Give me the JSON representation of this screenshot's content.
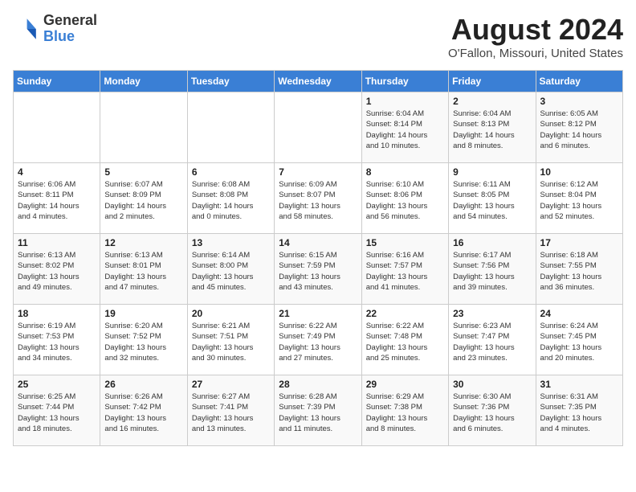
{
  "header": {
    "logo_line1": "General",
    "logo_line2": "Blue",
    "month": "August 2024",
    "location": "O'Fallon, Missouri, United States"
  },
  "weekdays": [
    "Sunday",
    "Monday",
    "Tuesday",
    "Wednesday",
    "Thursday",
    "Friday",
    "Saturday"
  ],
  "weeks": [
    [
      {
        "day": "",
        "info": ""
      },
      {
        "day": "",
        "info": ""
      },
      {
        "day": "",
        "info": ""
      },
      {
        "day": "",
        "info": ""
      },
      {
        "day": "1",
        "info": "Sunrise: 6:04 AM\nSunset: 8:14 PM\nDaylight: 14 hours\nand 10 minutes."
      },
      {
        "day": "2",
        "info": "Sunrise: 6:04 AM\nSunset: 8:13 PM\nDaylight: 14 hours\nand 8 minutes."
      },
      {
        "day": "3",
        "info": "Sunrise: 6:05 AM\nSunset: 8:12 PM\nDaylight: 14 hours\nand 6 minutes."
      }
    ],
    [
      {
        "day": "4",
        "info": "Sunrise: 6:06 AM\nSunset: 8:11 PM\nDaylight: 14 hours\nand 4 minutes."
      },
      {
        "day": "5",
        "info": "Sunrise: 6:07 AM\nSunset: 8:09 PM\nDaylight: 14 hours\nand 2 minutes."
      },
      {
        "day": "6",
        "info": "Sunrise: 6:08 AM\nSunset: 8:08 PM\nDaylight: 14 hours\nand 0 minutes."
      },
      {
        "day": "7",
        "info": "Sunrise: 6:09 AM\nSunset: 8:07 PM\nDaylight: 13 hours\nand 58 minutes."
      },
      {
        "day": "8",
        "info": "Sunrise: 6:10 AM\nSunset: 8:06 PM\nDaylight: 13 hours\nand 56 minutes."
      },
      {
        "day": "9",
        "info": "Sunrise: 6:11 AM\nSunset: 8:05 PM\nDaylight: 13 hours\nand 54 minutes."
      },
      {
        "day": "10",
        "info": "Sunrise: 6:12 AM\nSunset: 8:04 PM\nDaylight: 13 hours\nand 52 minutes."
      }
    ],
    [
      {
        "day": "11",
        "info": "Sunrise: 6:13 AM\nSunset: 8:02 PM\nDaylight: 13 hours\nand 49 minutes."
      },
      {
        "day": "12",
        "info": "Sunrise: 6:13 AM\nSunset: 8:01 PM\nDaylight: 13 hours\nand 47 minutes."
      },
      {
        "day": "13",
        "info": "Sunrise: 6:14 AM\nSunset: 8:00 PM\nDaylight: 13 hours\nand 45 minutes."
      },
      {
        "day": "14",
        "info": "Sunrise: 6:15 AM\nSunset: 7:59 PM\nDaylight: 13 hours\nand 43 minutes."
      },
      {
        "day": "15",
        "info": "Sunrise: 6:16 AM\nSunset: 7:57 PM\nDaylight: 13 hours\nand 41 minutes."
      },
      {
        "day": "16",
        "info": "Sunrise: 6:17 AM\nSunset: 7:56 PM\nDaylight: 13 hours\nand 39 minutes."
      },
      {
        "day": "17",
        "info": "Sunrise: 6:18 AM\nSunset: 7:55 PM\nDaylight: 13 hours\nand 36 minutes."
      }
    ],
    [
      {
        "day": "18",
        "info": "Sunrise: 6:19 AM\nSunset: 7:53 PM\nDaylight: 13 hours\nand 34 minutes."
      },
      {
        "day": "19",
        "info": "Sunrise: 6:20 AM\nSunset: 7:52 PM\nDaylight: 13 hours\nand 32 minutes."
      },
      {
        "day": "20",
        "info": "Sunrise: 6:21 AM\nSunset: 7:51 PM\nDaylight: 13 hours\nand 30 minutes."
      },
      {
        "day": "21",
        "info": "Sunrise: 6:22 AM\nSunset: 7:49 PM\nDaylight: 13 hours\nand 27 minutes."
      },
      {
        "day": "22",
        "info": "Sunrise: 6:22 AM\nSunset: 7:48 PM\nDaylight: 13 hours\nand 25 minutes."
      },
      {
        "day": "23",
        "info": "Sunrise: 6:23 AM\nSunset: 7:47 PM\nDaylight: 13 hours\nand 23 minutes."
      },
      {
        "day": "24",
        "info": "Sunrise: 6:24 AM\nSunset: 7:45 PM\nDaylight: 13 hours\nand 20 minutes."
      }
    ],
    [
      {
        "day": "25",
        "info": "Sunrise: 6:25 AM\nSunset: 7:44 PM\nDaylight: 13 hours\nand 18 minutes."
      },
      {
        "day": "26",
        "info": "Sunrise: 6:26 AM\nSunset: 7:42 PM\nDaylight: 13 hours\nand 16 minutes."
      },
      {
        "day": "27",
        "info": "Sunrise: 6:27 AM\nSunset: 7:41 PM\nDaylight: 13 hours\nand 13 minutes."
      },
      {
        "day": "28",
        "info": "Sunrise: 6:28 AM\nSunset: 7:39 PM\nDaylight: 13 hours\nand 11 minutes."
      },
      {
        "day": "29",
        "info": "Sunrise: 6:29 AM\nSunset: 7:38 PM\nDaylight: 13 hours\nand 8 minutes."
      },
      {
        "day": "30",
        "info": "Sunrise: 6:30 AM\nSunset: 7:36 PM\nDaylight: 13 hours\nand 6 minutes."
      },
      {
        "day": "31",
        "info": "Sunrise: 6:31 AM\nSunset: 7:35 PM\nDaylight: 13 hours\nand 4 minutes."
      }
    ]
  ]
}
